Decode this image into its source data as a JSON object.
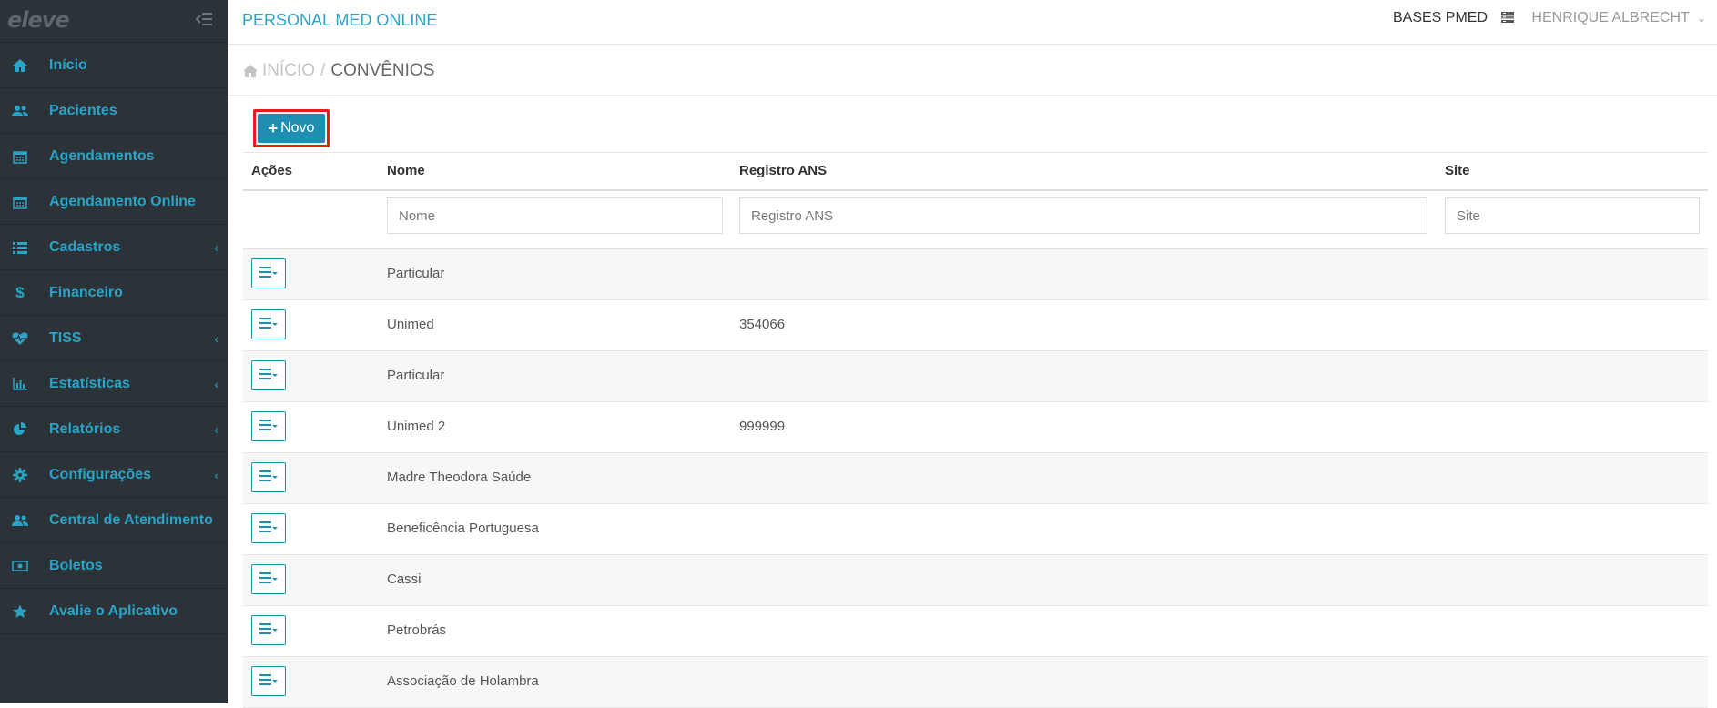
{
  "sidebar": {
    "logo": "eleve",
    "items": [
      {
        "label": "Início",
        "icon": "home-icon",
        "chevron": false
      },
      {
        "label": "Pacientes",
        "icon": "users-icon",
        "chevron": false
      },
      {
        "label": "Agendamentos",
        "icon": "calendar-icon",
        "chevron": false
      },
      {
        "label": "Agendamento Online",
        "icon": "calendar-icon",
        "chevron": false
      },
      {
        "label": "Cadastros",
        "icon": "list-icon",
        "chevron": true
      },
      {
        "label": "Financeiro",
        "icon": "dollar-icon",
        "chevron": false
      },
      {
        "label": "TISS",
        "icon": "heartbeat-icon",
        "chevron": true
      },
      {
        "label": "Estatísticas",
        "icon": "bar-chart-icon",
        "chevron": true
      },
      {
        "label": "Relatórios",
        "icon": "pie-chart-icon",
        "chevron": true
      },
      {
        "label": "Configurações",
        "icon": "gear-icon",
        "chevron": true
      },
      {
        "label": "Central de Atendimento",
        "icon": "users-icon",
        "chevron": false
      },
      {
        "label": "Boletos",
        "icon": "money-icon",
        "chevron": false
      },
      {
        "label": "Avalie o Aplicativo",
        "icon": "star-icon",
        "chevron": false
      }
    ]
  },
  "header": {
    "title": "PERSONAL MED ONLINE",
    "bases": "BASES PMED",
    "user": "HENRIQUE ALBRECHT"
  },
  "breadcrumb": {
    "home": "INÍCIO",
    "separator": "/",
    "current": "CONVÊNIOS"
  },
  "toolbar": {
    "new_label": "Novo"
  },
  "table": {
    "headers": {
      "acoes": "Ações",
      "nome": "Nome",
      "registro": "Registro ANS",
      "site": "Site"
    },
    "filters": {
      "nome": "Nome",
      "registro": "Registro ANS",
      "site": "Site"
    },
    "rows": [
      {
        "nome": "Particular",
        "registro": "",
        "site": ""
      },
      {
        "nome": "Unimed",
        "registro": "354066",
        "site": ""
      },
      {
        "nome": "Particular",
        "registro": "",
        "site": ""
      },
      {
        "nome": "Unimed 2",
        "registro": "999999",
        "site": ""
      },
      {
        "nome": "Madre Theodora Saúde",
        "registro": "",
        "site": ""
      },
      {
        "nome": "Beneficência Portuguesa",
        "registro": "",
        "site": ""
      },
      {
        "nome": "Cassi",
        "registro": "",
        "site": ""
      },
      {
        "nome": "Petrobrás",
        "registro": "",
        "site": ""
      },
      {
        "nome": "Associação de Holambra",
        "registro": "",
        "site": ""
      }
    ]
  },
  "colors": {
    "accent": "#2aa3c7",
    "sidebar_bg": "#2b3338",
    "button_bg": "#1e8fb3",
    "highlight": "#e81c1c"
  }
}
